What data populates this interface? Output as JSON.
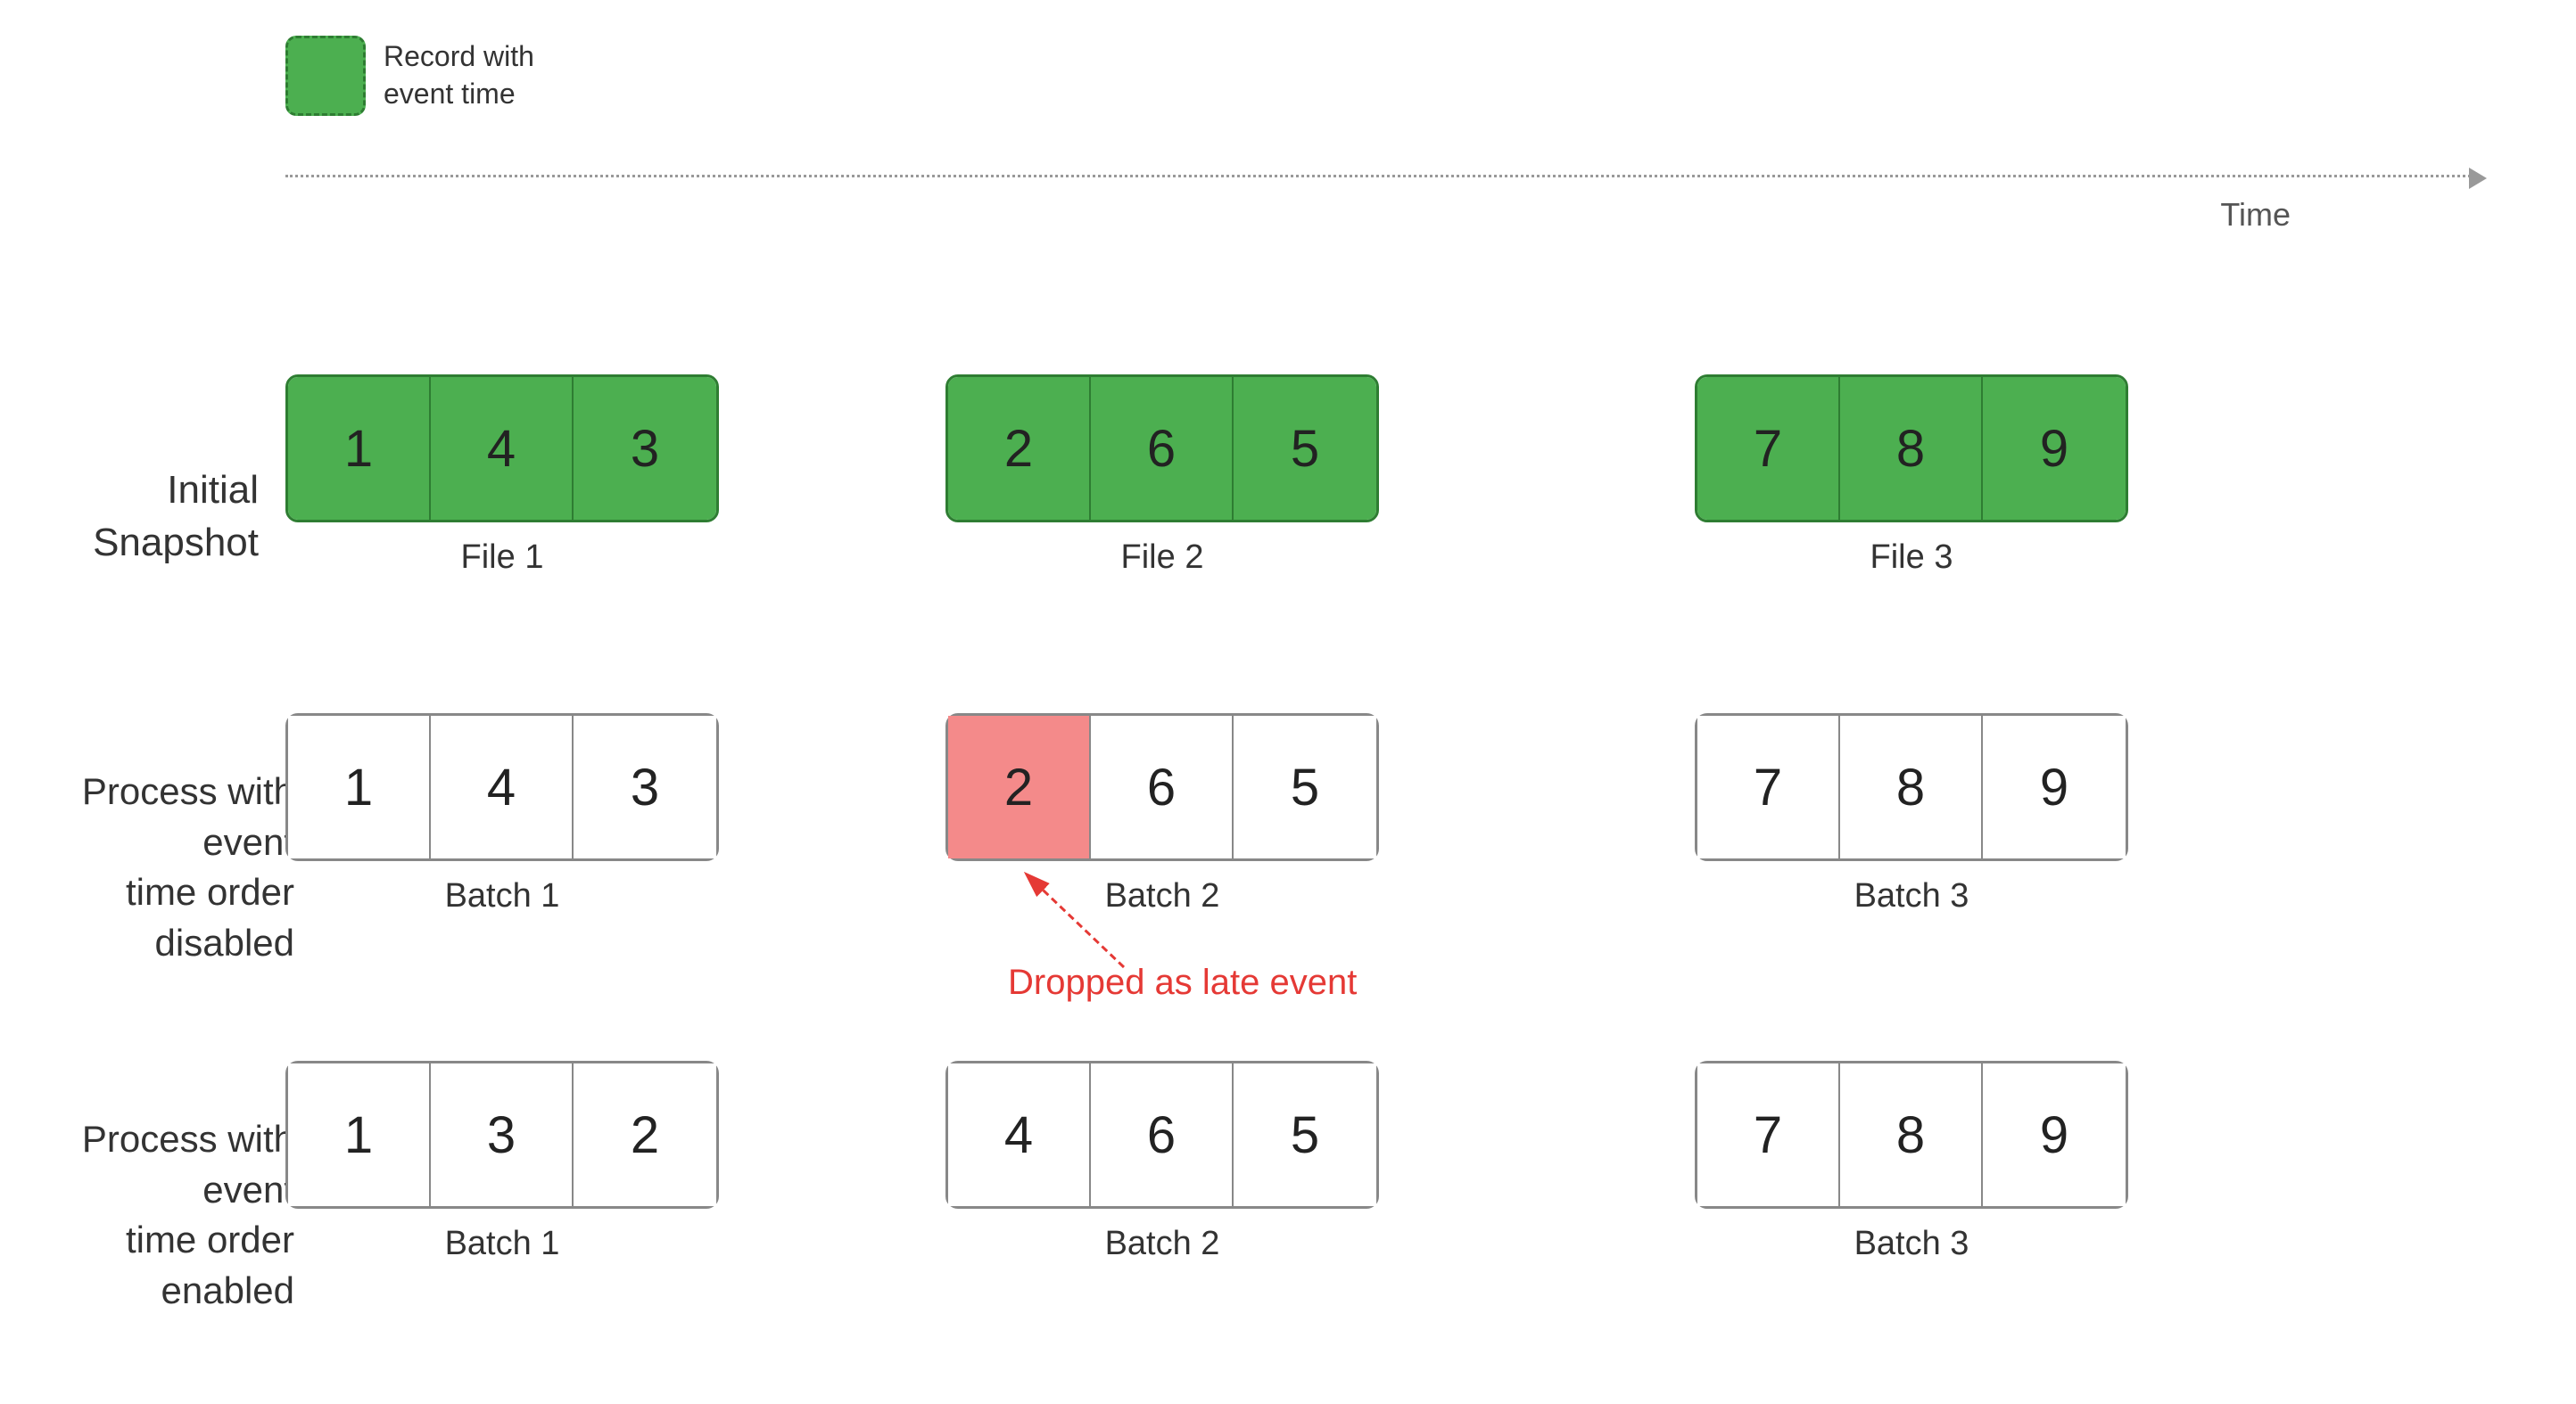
{
  "legend": {
    "box_label": "Record with\nevent time"
  },
  "timeline": {
    "label": "Time"
  },
  "rows": {
    "initial_snapshot": "Initial Snapshot",
    "event_time_disabled": "Process with event\ntime order disabled",
    "event_time_enabled": "Process with event\ntime order enabled"
  },
  "initial_snapshot": {
    "file1": {
      "label": "File 1",
      "values": [
        1,
        4,
        3
      ]
    },
    "file2": {
      "label": "File 2",
      "values": [
        2,
        6,
        5
      ]
    },
    "file3": {
      "label": "File 3",
      "values": [
        7,
        8,
        9
      ]
    }
  },
  "disabled": {
    "batch1": {
      "label": "Batch 1",
      "values": [
        1,
        4,
        3
      ],
      "colors": [
        "white",
        "white",
        "white"
      ]
    },
    "batch2": {
      "label": "Batch 2",
      "values": [
        2,
        6,
        5
      ],
      "colors": [
        "pink",
        "white",
        "white"
      ]
    },
    "batch3": {
      "label": "Batch 3",
      "values": [
        7,
        8,
        9
      ],
      "colors": [
        "white",
        "white",
        "white"
      ]
    }
  },
  "enabled": {
    "batch1": {
      "label": "Batch 1",
      "values": [
        1,
        3,
        2
      ],
      "colors": [
        "white",
        "white",
        "white"
      ]
    },
    "batch2": {
      "label": "Batch 2",
      "values": [
        4,
        6,
        5
      ],
      "colors": [
        "white",
        "white",
        "white"
      ]
    },
    "batch3": {
      "label": "Batch 3",
      "values": [
        7,
        8,
        9
      ],
      "colors": [
        "white",
        "white",
        "white"
      ]
    }
  },
  "dropped": {
    "label": "Dropped as late event"
  }
}
